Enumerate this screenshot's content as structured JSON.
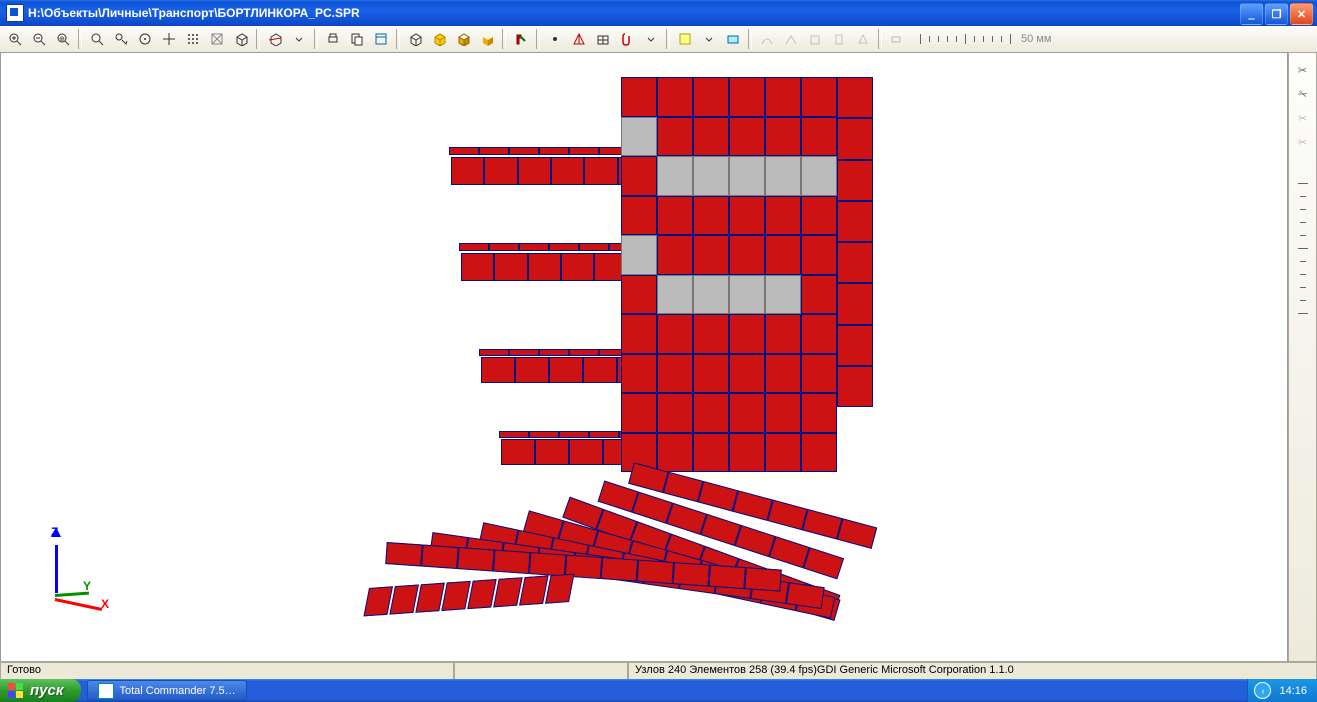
{
  "window": {
    "title": "H:\\Объекты\\Личные\\Транспорт\\БОРТЛИНКОРА_PC.SPR"
  },
  "toolbar": {
    "ruler_unit": "50 мм"
  },
  "axes": {
    "z": "Z",
    "y": "Y",
    "x": "X"
  },
  "status": {
    "left": "Готово",
    "right": "Узлов 240  Элементов 258  (39.4 fps)GDI Generic Microsoft Corporation 1.1.0"
  },
  "taskbar": {
    "start": "пуск",
    "items": [
      "Total Commander 7.5…"
    ],
    "clock": "14:16"
  }
}
